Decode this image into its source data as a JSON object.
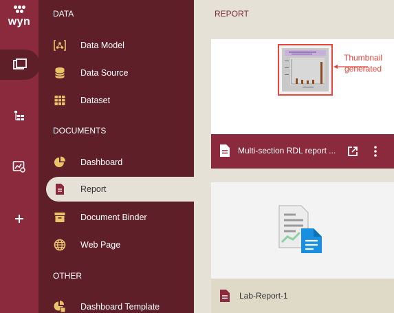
{
  "logo": {
    "text": "wyn"
  },
  "rail": {
    "items": [
      {
        "icon": "documents-icon",
        "active": true
      },
      {
        "icon": "hierarchy-icon"
      },
      {
        "icon": "analysis-icon"
      },
      {
        "icon": "plus-icon"
      }
    ]
  },
  "sidebar": {
    "sections": [
      {
        "heading": "DATA",
        "items": [
          {
            "label": "Data Model",
            "icon": "data-model-icon"
          },
          {
            "label": "Data Source",
            "icon": "database-icon"
          },
          {
            "label": "Dataset",
            "icon": "dataset-grid-icon"
          }
        ]
      },
      {
        "heading": "DOCUMENTS",
        "items": [
          {
            "label": "Dashboard",
            "icon": "dashboard-pie-icon"
          },
          {
            "label": "Report",
            "icon": "report-icon",
            "active": true
          },
          {
            "label": "Document Binder",
            "icon": "binder-icon"
          },
          {
            "label": "Web Page",
            "icon": "globe-icon"
          }
        ]
      },
      {
        "heading": "OTHER",
        "items": [
          {
            "label": "Dashboard Template",
            "icon": "dashboard-template-icon"
          }
        ]
      }
    ]
  },
  "main": {
    "title": "REPORT",
    "cards": [
      {
        "title": "Multi-section RDL report ...",
        "thumbnail_note": "Thumbnail generated",
        "thumbnail_note_line1": "Thumbnail",
        "thumbnail_note_line2": "generated",
        "actions": [
          "open-external-icon",
          "more-vertical-icon"
        ]
      },
      {
        "title": "Lab-Report-1"
      }
    ]
  },
  "colors": {
    "rail": "#8b2a3d",
    "sidebar": "#5e1f29",
    "content_bg": "#e6e1d6",
    "icon_gold": "#e9c46a",
    "callout_red": "#e8453c"
  }
}
